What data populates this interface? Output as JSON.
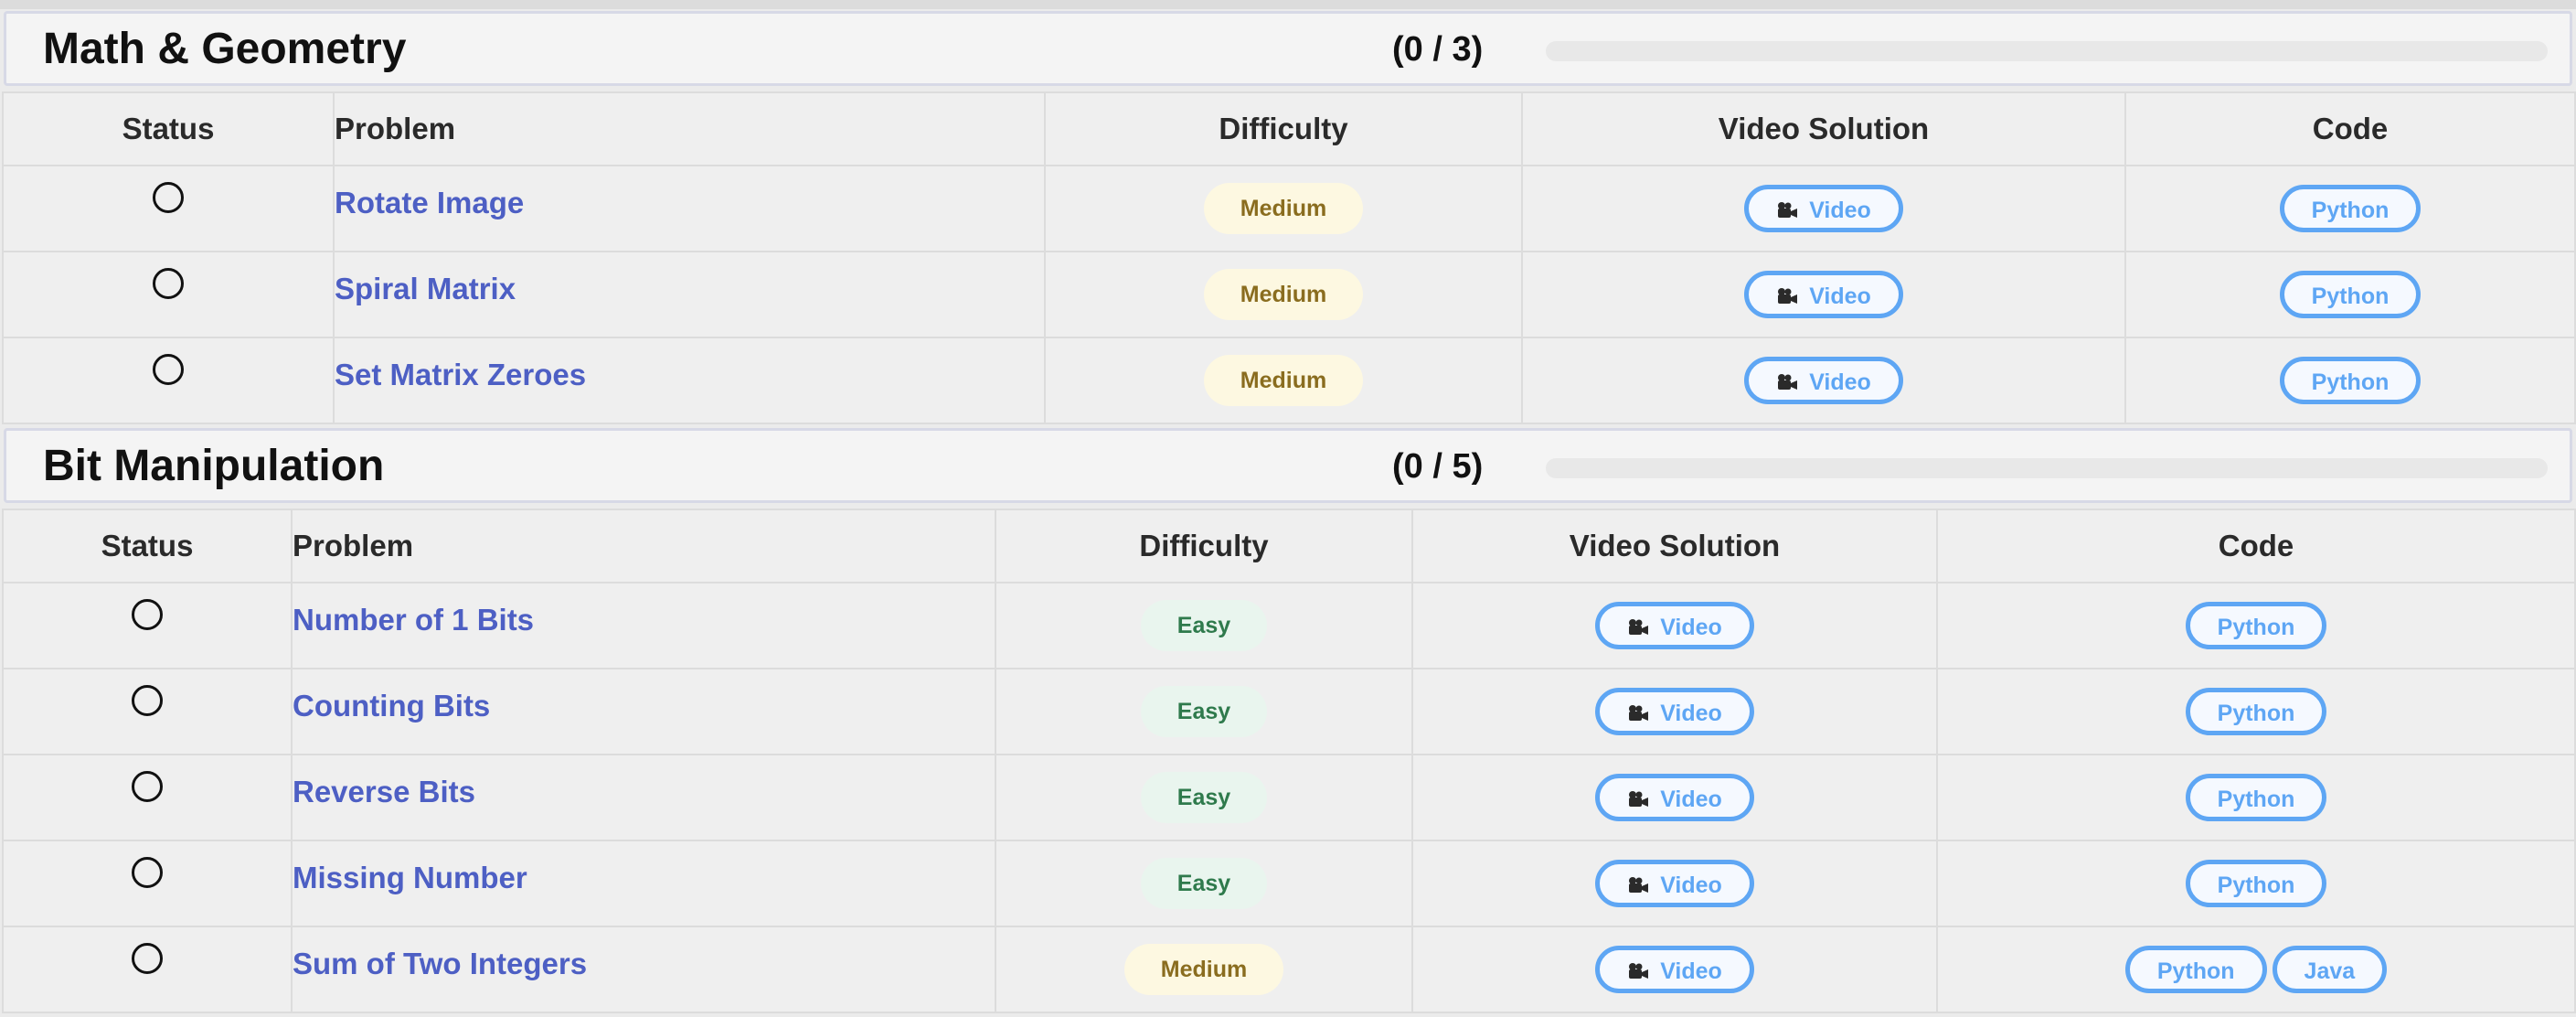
{
  "sections": [
    {
      "title": "Math & Geometry",
      "count": "(0 / 3)",
      "progress": 0,
      "headers": {
        "status": "Status",
        "problem": "Problem",
        "difficulty": "Difficulty",
        "video": "Video Solution",
        "code": "Code"
      },
      "rows": [
        {
          "problem": "Rotate Image",
          "difficulty": "Medium",
          "video": "Video",
          "code": [
            "Python"
          ]
        },
        {
          "problem": "Spiral Matrix",
          "difficulty": "Medium",
          "video": "Video",
          "code": [
            "Python"
          ]
        },
        {
          "problem": "Set Matrix Zeroes",
          "difficulty": "Medium",
          "video": "Video",
          "code": [
            "Python"
          ]
        }
      ]
    },
    {
      "title": "Bit Manipulation",
      "count": "(0 / 5)",
      "progress": 0,
      "headers": {
        "status": "Status",
        "problem": "Problem",
        "difficulty": "Difficulty",
        "video": "Video Solution",
        "code": "Code"
      },
      "rows": [
        {
          "problem": "Number of 1 Bits",
          "difficulty": "Easy",
          "video": "Video",
          "code": [
            "Python"
          ]
        },
        {
          "problem": "Counting Bits",
          "difficulty": "Easy",
          "video": "Video",
          "code": [
            "Python"
          ]
        },
        {
          "problem": "Reverse Bits",
          "difficulty": "Easy",
          "video": "Video",
          "code": [
            "Python"
          ]
        },
        {
          "problem": "Missing Number",
          "difficulty": "Easy",
          "video": "Video",
          "code": [
            "Python"
          ]
        },
        {
          "problem": "Sum of Two Integers",
          "difficulty": "Medium",
          "video": "Video",
          "code": [
            "Python",
            "Java"
          ]
        }
      ]
    }
  ],
  "icons": {
    "status": "empty-circle-icon",
    "video": "video-camera-icon"
  },
  "colors": {
    "link": "#4d5fc4",
    "button_border": "#5ea6f4",
    "medium_bg": "#fdf8e1",
    "medium_text": "#8a6d1f",
    "easy_bg": "#e9f5ee",
    "easy_text": "#2f7a4c"
  }
}
